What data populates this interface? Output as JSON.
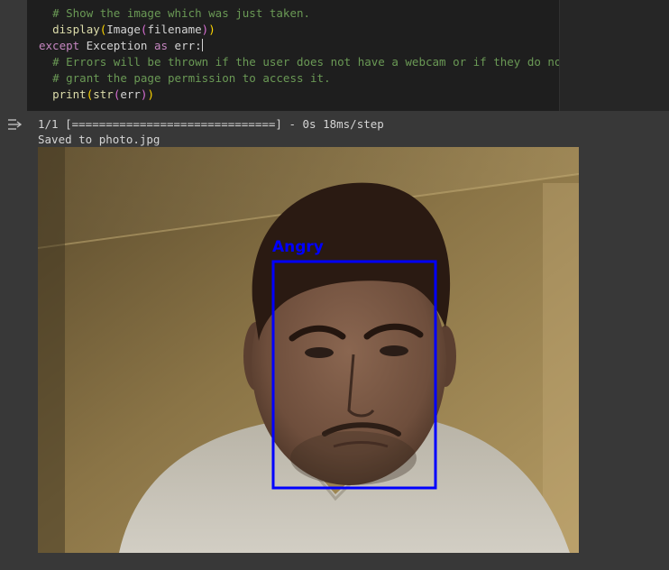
{
  "code": {
    "lines": [
      {
        "indent": "  ",
        "segments": [
          {
            "cls": "c-comment",
            "text": "# Show the image which was just taken."
          }
        ]
      },
      {
        "indent": "  ",
        "segments": [
          {
            "cls": "c-fn",
            "text": "display"
          },
          {
            "cls": "c-paren1",
            "text": "("
          },
          {
            "cls": "c-class",
            "text": "Image"
          },
          {
            "cls": "c-paren2",
            "text": "("
          },
          {
            "cls": "c-ident",
            "text": "filename"
          },
          {
            "cls": "c-paren2",
            "text": ")"
          },
          {
            "cls": "c-paren1",
            "text": ")"
          }
        ]
      },
      {
        "indent": "",
        "caret": true,
        "segments": [
          {
            "cls": "c-keyword",
            "text": "except"
          },
          {
            "cls": "c-ident",
            "text": " Exception "
          },
          {
            "cls": "c-keyword",
            "text": "as"
          },
          {
            "cls": "c-ident",
            "text": " err:"
          }
        ]
      },
      {
        "indent": "  ",
        "segments": [
          {
            "cls": "c-comment",
            "text": "# Errors will be thrown if the user does not have a webcam or if they do not"
          }
        ]
      },
      {
        "indent": "  ",
        "segments": [
          {
            "cls": "c-comment",
            "text": "# grant the page permission to access it."
          }
        ]
      },
      {
        "indent": "  ",
        "segments": [
          {
            "cls": "c-fn",
            "text": "print"
          },
          {
            "cls": "c-paren1",
            "text": "("
          },
          {
            "cls": "c-fn",
            "text": "str"
          },
          {
            "cls": "c-paren2",
            "text": "("
          },
          {
            "cls": "c-ident",
            "text": "err"
          },
          {
            "cls": "c-paren2",
            "text": ")"
          },
          {
            "cls": "c-paren1",
            "text": ")"
          }
        ]
      }
    ]
  },
  "output": {
    "toggle_icon": "output-toggle-icon",
    "progress_line": "1/1 [==============================] - 0s 18ms/step",
    "saved_line": "Saved to photo.jpg",
    "detection": {
      "label": "Angry",
      "color": "#0000ff"
    }
  },
  "colors": {
    "background": "#383838",
    "editor_bg": "#1e1e1e",
    "comment": "#6a9955",
    "keyword": "#c586c0",
    "function": "#dcdcaa",
    "bbox": "#0000ff"
  }
}
